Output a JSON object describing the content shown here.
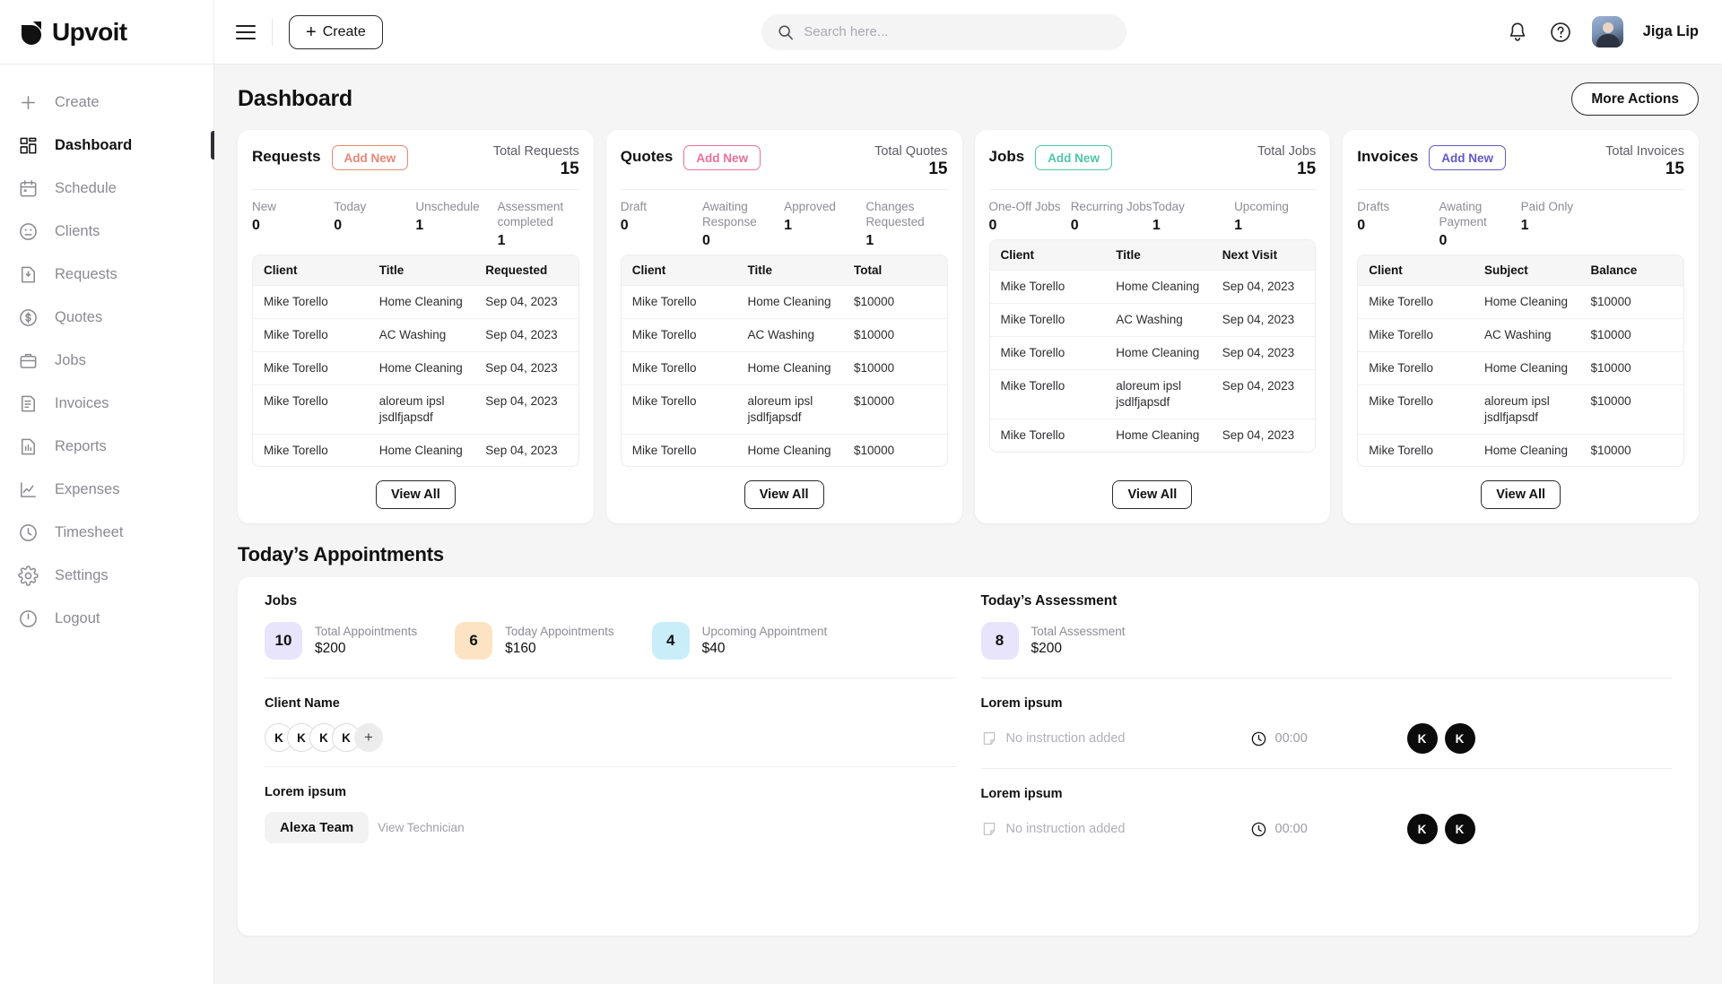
{
  "brand": {
    "name": "Upvoit"
  },
  "sidebar": {
    "items": [
      {
        "label": "Create",
        "icon": "plus-icon",
        "active": false
      },
      {
        "label": "Dashboard",
        "icon": "grid-icon",
        "active": true
      },
      {
        "label": "Schedule",
        "icon": "calendar-icon",
        "active": false
      },
      {
        "label": "Clients",
        "icon": "clients-icon",
        "active": false
      },
      {
        "label": "Requests",
        "icon": "request-icon",
        "active": false
      },
      {
        "label": "Quotes",
        "icon": "dollar-icon",
        "active": false
      },
      {
        "label": "Jobs",
        "icon": "briefcase-icon",
        "active": false
      },
      {
        "label": "Invoices",
        "icon": "invoice-icon",
        "active": false
      },
      {
        "label": "Reports",
        "icon": "report-icon",
        "active": false
      },
      {
        "label": "Expenses",
        "icon": "chart-line-icon",
        "active": false
      },
      {
        "label": "Timesheet",
        "icon": "clock-icon",
        "active": false
      },
      {
        "label": "Settings",
        "icon": "gear-icon",
        "active": false
      },
      {
        "label": "Logout",
        "icon": "logout-icon",
        "active": false
      }
    ]
  },
  "topbar": {
    "menu_icon": "hamburger-icon",
    "create_label": "Create",
    "search_placeholder": "Search here...",
    "search_value": "",
    "search_icon": "search-icon",
    "notification_icon": "bell-icon",
    "help_icon": "question-circle-icon",
    "user_name": "Jiga Lip",
    "avatar": "user-avatar"
  },
  "page": {
    "title": "Dashboard",
    "more_actions_label": "More Actions"
  },
  "cards": [
    {
      "id": "requests",
      "title": "Requests",
      "add_label": "Add New",
      "accent": "#e78876",
      "total_label": "Total Requests",
      "total_value": "15",
      "stats": [
        {
          "label": "New",
          "value": "0"
        },
        {
          "label": "Today",
          "value": "0"
        },
        {
          "label": "Unschedule",
          "value": "1"
        },
        {
          "label": "Assessment completed",
          "value": "1"
        }
      ],
      "columns": [
        "Client",
        "Title",
        "Requested"
      ],
      "rows": [
        [
          "Mike Torello",
          "Home Cleaning",
          "Sep 04, 2023"
        ],
        [
          "Mike Torello",
          "AC Washing",
          "Sep 04, 2023"
        ],
        [
          "Mike Torello",
          "Home Cleaning",
          "Sep 04, 2023"
        ],
        [
          "Mike Torello",
          "aloreum ipsl jsdlfjapsdf",
          "Sep 04, 2023"
        ],
        [
          "Mike Torello",
          "Home Cleaning",
          "Sep 04, 2023"
        ]
      ],
      "view_all_label": "View All"
    },
    {
      "id": "quotes",
      "title": "Quotes",
      "add_label": "Add New",
      "accent": "#ec6f97",
      "total_label": "Total Quotes",
      "total_value": "15",
      "stats": [
        {
          "label": "Draft",
          "value": "0"
        },
        {
          "label": "Awaiting Response",
          "value": "0"
        },
        {
          "label": "Approved",
          "value": "1"
        },
        {
          "label": "Changes Requested",
          "value": "1"
        }
      ],
      "columns": [
        "Client",
        "Title",
        "Total"
      ],
      "rows": [
        [
          "Mike Torello",
          "Home Cleaning",
          "$10000"
        ],
        [
          "Mike Torello",
          "AC Washing",
          "$10000"
        ],
        [
          "Mike Torello",
          "Home Cleaning",
          "$10000"
        ],
        [
          "Mike Torello",
          "aloreum ipsl jsdlfjapsdf",
          "$10000"
        ],
        [
          "Mike Torello",
          "Home Cleaning",
          "$10000"
        ]
      ],
      "view_all_label": "View All"
    },
    {
      "id": "jobs",
      "title": "Jobs",
      "add_label": "Add New",
      "accent": "#4ec7a8",
      "total_label": "Total Jobs",
      "total_value": "15",
      "stats": [
        {
          "label": "One-Off Jobs",
          "value": "0"
        },
        {
          "label": "Recurring Jobs",
          "value": "0"
        },
        {
          "label": "Today",
          "value": "1"
        },
        {
          "label": "Upcoming",
          "value": "1"
        }
      ],
      "columns": [
        "Client",
        "Title",
        "Next Visit"
      ],
      "rows": [
        [
          "Mike Torello",
          "Home Cleaning",
          "Sep 04, 2023"
        ],
        [
          "Mike Torello",
          "AC Washing",
          "Sep 04, 2023"
        ],
        [
          "Mike Torello",
          "Home Cleaning",
          "Sep 04, 2023"
        ],
        [
          "Mike Torello",
          "aloreum ipsl jsdlfjapsdf",
          "Sep 04, 2023"
        ],
        [
          "Mike Torello",
          "Home Cleaning",
          "Sep 04, 2023"
        ]
      ],
      "view_all_label": "View All"
    },
    {
      "id": "invoices",
      "title": "Invoices",
      "add_label": "Add New",
      "accent": "#6259c8",
      "total_label": "Total Invoices",
      "total_value": "15",
      "stats": [
        {
          "label": "Drafts",
          "value": "0"
        },
        {
          "label": "Awating Payment",
          "value": "0"
        },
        {
          "label": "Paid Only",
          "value": "1"
        },
        {
          "label": "",
          "value": ""
        }
      ],
      "columns": [
        "Client",
        "Subject",
        "Balance"
      ],
      "rows": [
        [
          "Mike Torello",
          "Home Cleaning",
          "$10000"
        ],
        [
          "Mike Torello",
          "AC Washing",
          "$10000"
        ],
        [
          "Mike Torello",
          "Home Cleaning",
          "$10000"
        ],
        [
          "Mike Torello",
          "aloreum ipsl jsdlfjapsdf",
          "$10000"
        ],
        [
          "Mike Torello",
          "Home Cleaning",
          "$10000"
        ]
      ],
      "view_all_label": "View All"
    }
  ],
  "appointments": {
    "section_title": "Today’s Appointments",
    "jobs": {
      "heading": "Jobs",
      "metrics": [
        {
          "count": "10",
          "label": "Total Appointments",
          "amount": "$200",
          "color": "#e7e4fb"
        },
        {
          "count": "6",
          "label": "Today Appointments",
          "amount": "$160",
          "color": "#fbe3c4"
        },
        {
          "count": "4",
          "label": "Upcoming Appointment",
          "amount": "$40",
          "color": "#c9eefa"
        }
      ],
      "client_block": {
        "heading": "Client Name",
        "avatars": [
          "K",
          "K",
          "K",
          "K"
        ],
        "add_icon": "plus-icon"
      },
      "team_block": {
        "heading": "Lorem ipsum",
        "team_name": "Alexa Team",
        "view_label": "View Technician"
      }
    },
    "assessment": {
      "heading": "Today’s Assessment",
      "metrics": [
        {
          "count": "8",
          "label": "Total Assessment",
          "amount": "$200",
          "color": "#e7e4fb"
        }
      ],
      "rows": [
        {
          "heading": "Lorem ipsum",
          "note_icon": "note-icon",
          "note_text": "No instruction added",
          "clock_icon": "clock-icon",
          "time": "00:00",
          "avatars": [
            "K",
            "K"
          ]
        },
        {
          "heading": "Lorem ipsum",
          "note_icon": "note-icon",
          "note_text": "No instruction added",
          "clock_icon": "clock-icon",
          "time": "00:00",
          "avatars": [
            "K",
            "K"
          ]
        }
      ]
    }
  }
}
